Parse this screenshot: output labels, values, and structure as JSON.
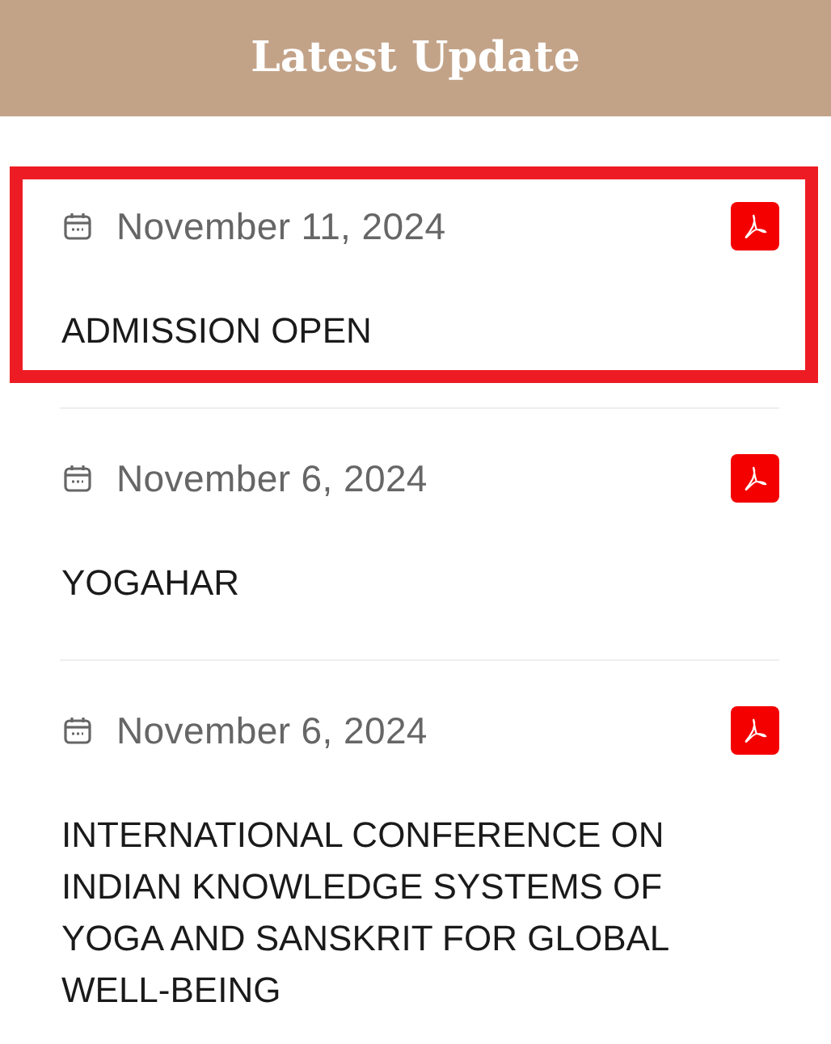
{
  "header": {
    "title": "Latest Update"
  },
  "updates": [
    {
      "date": "November 11, 2024",
      "title": "ADMISSION OPEN",
      "selected": true
    },
    {
      "date": "November 6, 2024",
      "title": "YOGAHAR",
      "selected": false
    },
    {
      "date": "November 6, 2024",
      "title": "INTERNATIONAL CONFERENCE ON INDIAN KNOWLEDGE SYSTEMS OF YOGA AND SANSKRIT FOR GLOBAL WELL-BEING",
      "selected": false
    }
  ]
}
